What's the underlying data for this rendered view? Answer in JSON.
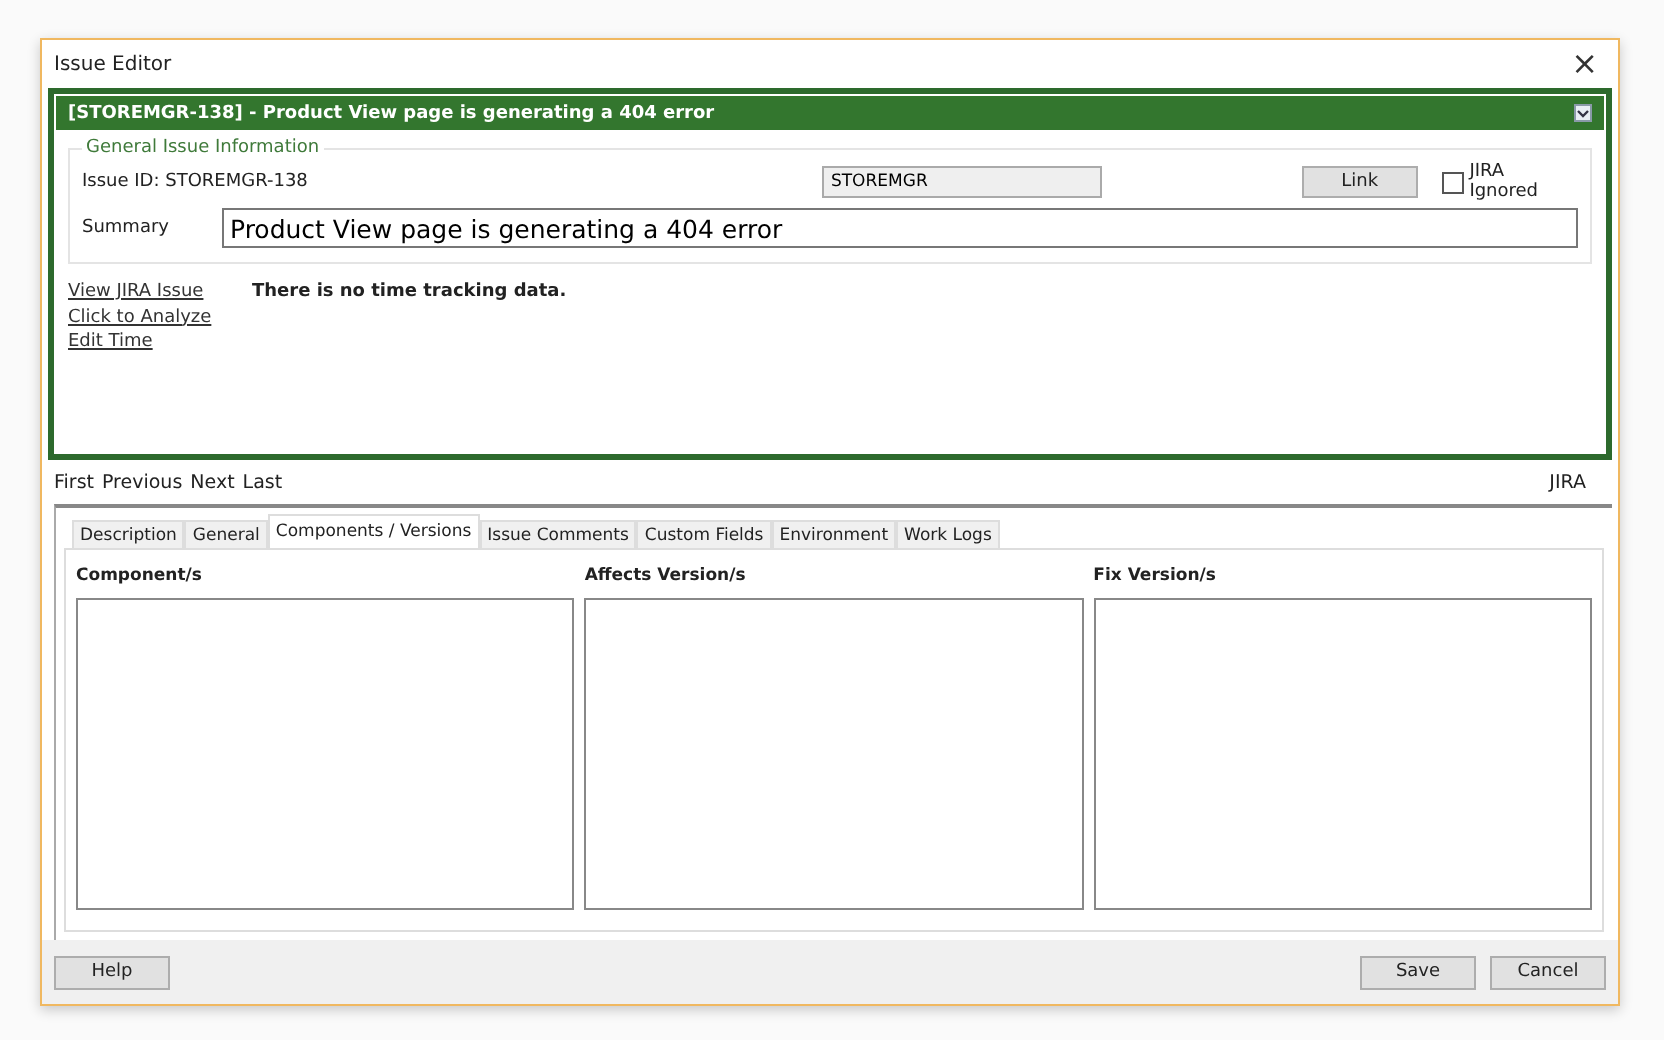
{
  "window": {
    "title": "Issue Editor",
    "close": "×"
  },
  "issue_header": {
    "title": "[STOREMGR-138] - Product View page is generating a 404 error"
  },
  "general": {
    "legend": "General Issue Information",
    "issue_id": "Issue ID: STOREMGR-138",
    "project": "STOREMGR",
    "link_button": "Link",
    "jira_ignored": {
      "label": "JIRA Ignored",
      "checked": false
    },
    "summary_label": "Summary",
    "summary": "Product View page is generating a 404 error"
  },
  "links": [
    "View JIRA Issue",
    "Click to Analyze",
    "Edit Time"
  ],
  "time_tracking": "There is no time tracking data.",
  "navigation": [
    "First",
    "Previous",
    "Next",
    "Last"
  ],
  "source": "JIRA",
  "tabs": [
    {
      "label": "Description",
      "selected": false
    },
    {
      "label": "General",
      "selected": false
    },
    {
      "label": "Components / Versions",
      "selected": true
    },
    {
      "label": "Issue Comments",
      "selected": false
    },
    {
      "label": "Custom Fields",
      "selected": false
    },
    {
      "label": "Environment",
      "selected": false
    },
    {
      "label": "Work Logs",
      "selected": false
    }
  ],
  "lists": [
    {
      "label": "Component/s"
    },
    {
      "label": "Affects Version/s"
    },
    {
      "label": "Fix Version/s"
    }
  ],
  "footer": {
    "help": "Help",
    "save": "Save",
    "cancel": "Cancel"
  }
}
